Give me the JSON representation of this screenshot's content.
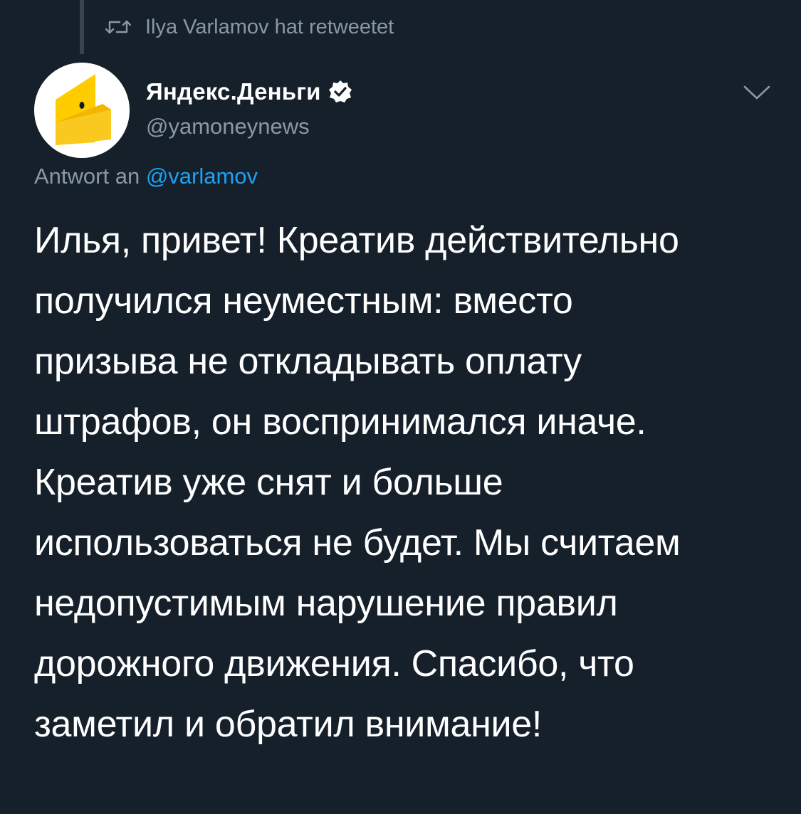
{
  "retweet": {
    "icon": "retweet-icon",
    "text": "Ilya Varlamov hat retweetet"
  },
  "author": {
    "display_name": "Яндекс.Деньги",
    "handle": "@yamoneynews",
    "verified_icon": "verified-badge-icon",
    "avatar_icon": "yandex-money-wallet-logo"
  },
  "menu": {
    "icon": "chevron-down-icon"
  },
  "reply": {
    "prefix": "Antwort an",
    "mention": "@varlamov"
  },
  "tweet": {
    "text": "Илья, привет! Креатив действительно\nполучился неуместным: вместо\nпризыва не откладывать оплату\nштрафов, он воспринимался иначе.\nКреатив уже снят и больше\nиспользоваться не будет. Мы считаем\nнедопустимым нарушение правил\nдорожного движения. Спасибо, что\nзаметил и обратил внимание!"
  },
  "colors": {
    "background": "#15202b",
    "secondary_text": "#8899a6",
    "link": "#1da1f2",
    "logo_yellow": "#ffcc00"
  }
}
